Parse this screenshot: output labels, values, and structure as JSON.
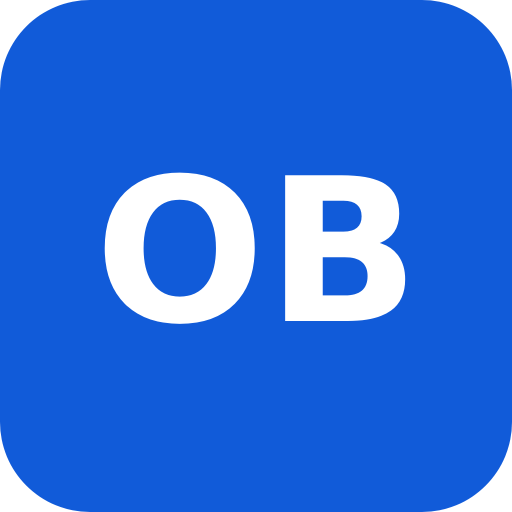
{
  "app_icon": {
    "monogram": "OB",
    "background_color": "#115bd9",
    "text_color": "#ffffff"
  }
}
